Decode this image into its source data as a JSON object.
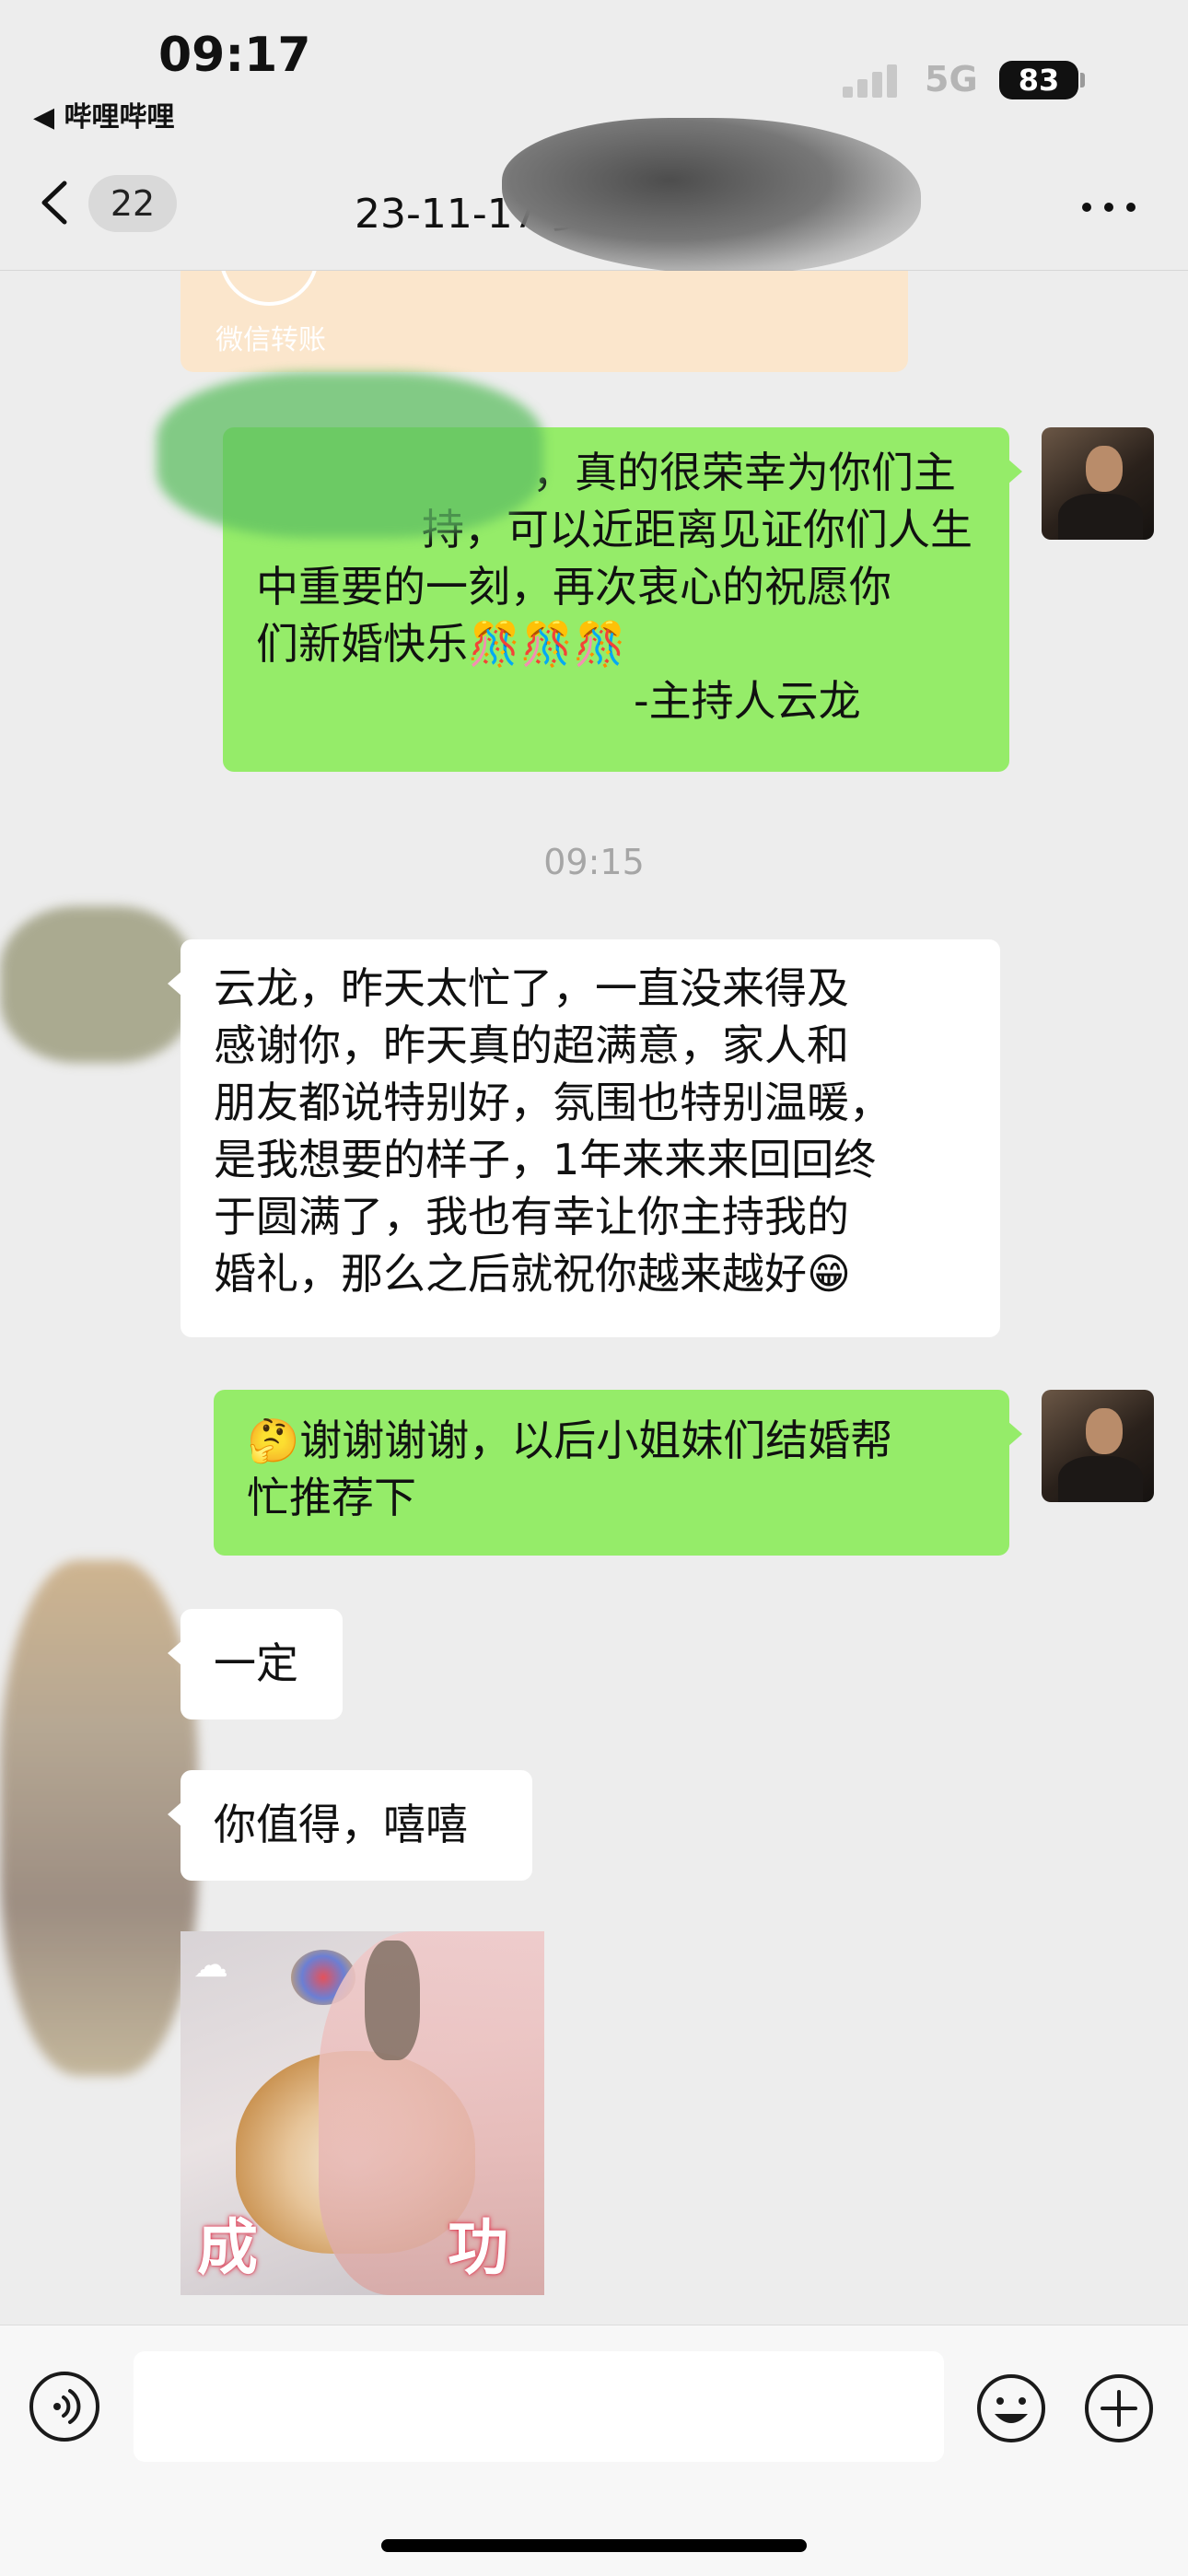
{
  "status_bar": {
    "time": "09:17",
    "back_app": "◀ 哔哩哔哩",
    "network": "5G",
    "battery": "83"
  },
  "nav": {
    "unread_count": "22",
    "title": "23-11-17 婺"
  },
  "transfer": {
    "label": "微信转账"
  },
  "messages": [
    {
      "from": "me",
      "lines": [
        "，真的很荣幸为你们主",
        "持，可以近距离见证你们人生",
        "中重要的一刻，再次衷心的祝愿你",
        "们新婚快乐🎊🎊🎊",
        "-主持人云龙"
      ]
    },
    {
      "from": "them",
      "lines": [
        "云龙，昨天太忙了，一直没来得及",
        "感谢你，昨天真的超满意，家人和",
        "朋友都说特别好，氛围也特别温暖，",
        "是我想要的样子，1年来来来回回终",
        "于圆满了，我也有幸让你主持我的",
        "婚礼，那么之后就祝你越来越好😁"
      ]
    },
    {
      "from": "me",
      "lines": [
        "🤔谢谢谢谢，以后小姐妹们结婚帮",
        "忙推荐下"
      ]
    },
    {
      "from": "them",
      "lines": [
        "一定"
      ]
    },
    {
      "from": "them",
      "lines": [
        "你值得，嘻嘻"
      ]
    }
  ],
  "timestamp": "09:15",
  "sticker": {
    "caption_left": "成",
    "caption_right": "功"
  },
  "input": {
    "value": "",
    "placeholder": ""
  },
  "colors": {
    "background": "#ededed",
    "my_bubble": "#95ec69",
    "their_bubble": "#ffffff",
    "transfer_card": "#fbe6cc"
  },
  "icons": [
    "back-chevron-icon",
    "more-icon",
    "voice-icon",
    "emoji-icon",
    "plus-icon",
    "signal-icon",
    "battery-icon"
  ]
}
